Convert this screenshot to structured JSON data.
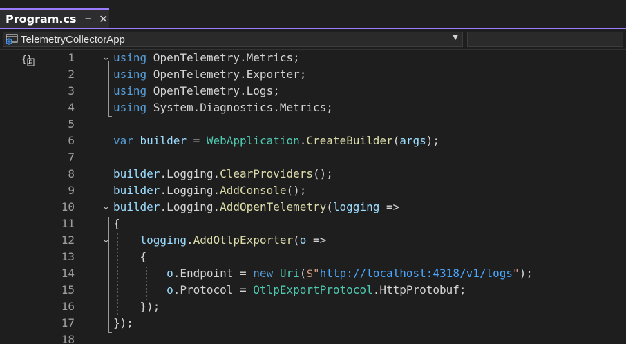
{
  "tab": {
    "title": "Program.cs",
    "pin": "⊣",
    "close": "✕"
  },
  "navbar": {
    "project": "TelemetryCollectorApp",
    "arrow": "▼"
  },
  "editor": {
    "codelens_icon": "{}",
    "lines": [
      {
        "num": "1",
        "tokens": [
          {
            "t": "using",
            "c": "kw"
          },
          {
            "t": " OpenTelemetry.Metrics;",
            "c": "punc"
          }
        ]
      },
      {
        "num": "2",
        "tokens": [
          {
            "t": "using",
            "c": "kw"
          },
          {
            "t": " OpenTelemetry.Exporter;",
            "c": "punc"
          }
        ]
      },
      {
        "num": "3",
        "tokens": [
          {
            "t": "using",
            "c": "kw"
          },
          {
            "t": " OpenTelemetry.Logs;",
            "c": "punc"
          }
        ]
      },
      {
        "num": "4",
        "tokens": [
          {
            "t": "using",
            "c": "kw"
          },
          {
            "t": " System.Diagnostics.Metrics;",
            "c": "punc"
          }
        ]
      },
      {
        "num": "5",
        "tokens": []
      },
      {
        "num": "6",
        "tokens": [
          {
            "t": "var",
            "c": "kw"
          },
          {
            "t": " ",
            "c": "punc"
          },
          {
            "t": "builder",
            "c": "var"
          },
          {
            "t": " = ",
            "c": "punc"
          },
          {
            "t": "WebApplication",
            "c": "type"
          },
          {
            "t": ".",
            "c": "punc"
          },
          {
            "t": "CreateBuilder",
            "c": "method"
          },
          {
            "t": "(",
            "c": "punc"
          },
          {
            "t": "args",
            "c": "var"
          },
          {
            "t": ");",
            "c": "punc"
          }
        ]
      },
      {
        "num": "7",
        "tokens": []
      },
      {
        "num": "8",
        "tokens": [
          {
            "t": "builder",
            "c": "var"
          },
          {
            "t": ".Logging.",
            "c": "punc"
          },
          {
            "t": "ClearProviders",
            "c": "method"
          },
          {
            "t": "();",
            "c": "punc"
          }
        ]
      },
      {
        "num": "9",
        "tokens": [
          {
            "t": "builder",
            "c": "var"
          },
          {
            "t": ".Logging.",
            "c": "punc"
          },
          {
            "t": "AddConsole",
            "c": "method"
          },
          {
            "t": "();",
            "c": "punc"
          }
        ]
      },
      {
        "num": "10",
        "tokens": [
          {
            "t": "builder",
            "c": "var"
          },
          {
            "t": ".Logging.",
            "c": "punc"
          },
          {
            "t": "AddOpenTelemetry",
            "c": "method"
          },
          {
            "t": "(",
            "c": "punc"
          },
          {
            "t": "logging",
            "c": "var"
          },
          {
            "t": " =>",
            "c": "punc"
          }
        ]
      },
      {
        "num": "11",
        "tokens": [
          {
            "t": "{",
            "c": "punc"
          }
        ]
      },
      {
        "num": "12",
        "tokens": [
          {
            "t": "    ",
            "c": "punc"
          },
          {
            "t": "logging",
            "c": "var"
          },
          {
            "t": ".",
            "c": "punc"
          },
          {
            "t": "AddOtlpExporter",
            "c": "method"
          },
          {
            "t": "(",
            "c": "punc"
          },
          {
            "t": "o",
            "c": "var"
          },
          {
            "t": " =>",
            "c": "punc"
          }
        ]
      },
      {
        "num": "13",
        "tokens": [
          {
            "t": "    {",
            "c": "punc"
          }
        ]
      },
      {
        "num": "14",
        "tokens": [
          {
            "t": "        ",
            "c": "punc"
          },
          {
            "t": "o",
            "c": "var"
          },
          {
            "t": ".Endpoint = ",
            "c": "punc"
          },
          {
            "t": "new",
            "c": "kw"
          },
          {
            "t": " ",
            "c": "punc"
          },
          {
            "t": "Uri",
            "c": "type"
          },
          {
            "t": "(",
            "c": "punc"
          },
          {
            "t": "$\"",
            "c": "str"
          },
          {
            "t": "http://localhost:4318/v1/logs",
            "c": "url"
          },
          {
            "t": "\"",
            "c": "str"
          },
          {
            "t": ");",
            "c": "punc"
          }
        ]
      },
      {
        "num": "15",
        "tokens": [
          {
            "t": "        ",
            "c": "punc"
          },
          {
            "t": "o",
            "c": "var"
          },
          {
            "t": ".Protocol = ",
            "c": "punc"
          },
          {
            "t": "OtlpExportProtocol",
            "c": "type"
          },
          {
            "t": ".HttpProtobuf;",
            "c": "punc"
          }
        ]
      },
      {
        "num": "16",
        "tokens": [
          {
            "t": "    });",
            "c": "punc"
          }
        ]
      },
      {
        "num": "17",
        "tokens": [
          {
            "t": "});",
            "c": "punc"
          }
        ]
      },
      {
        "num": "18",
        "tokens": []
      }
    ]
  }
}
